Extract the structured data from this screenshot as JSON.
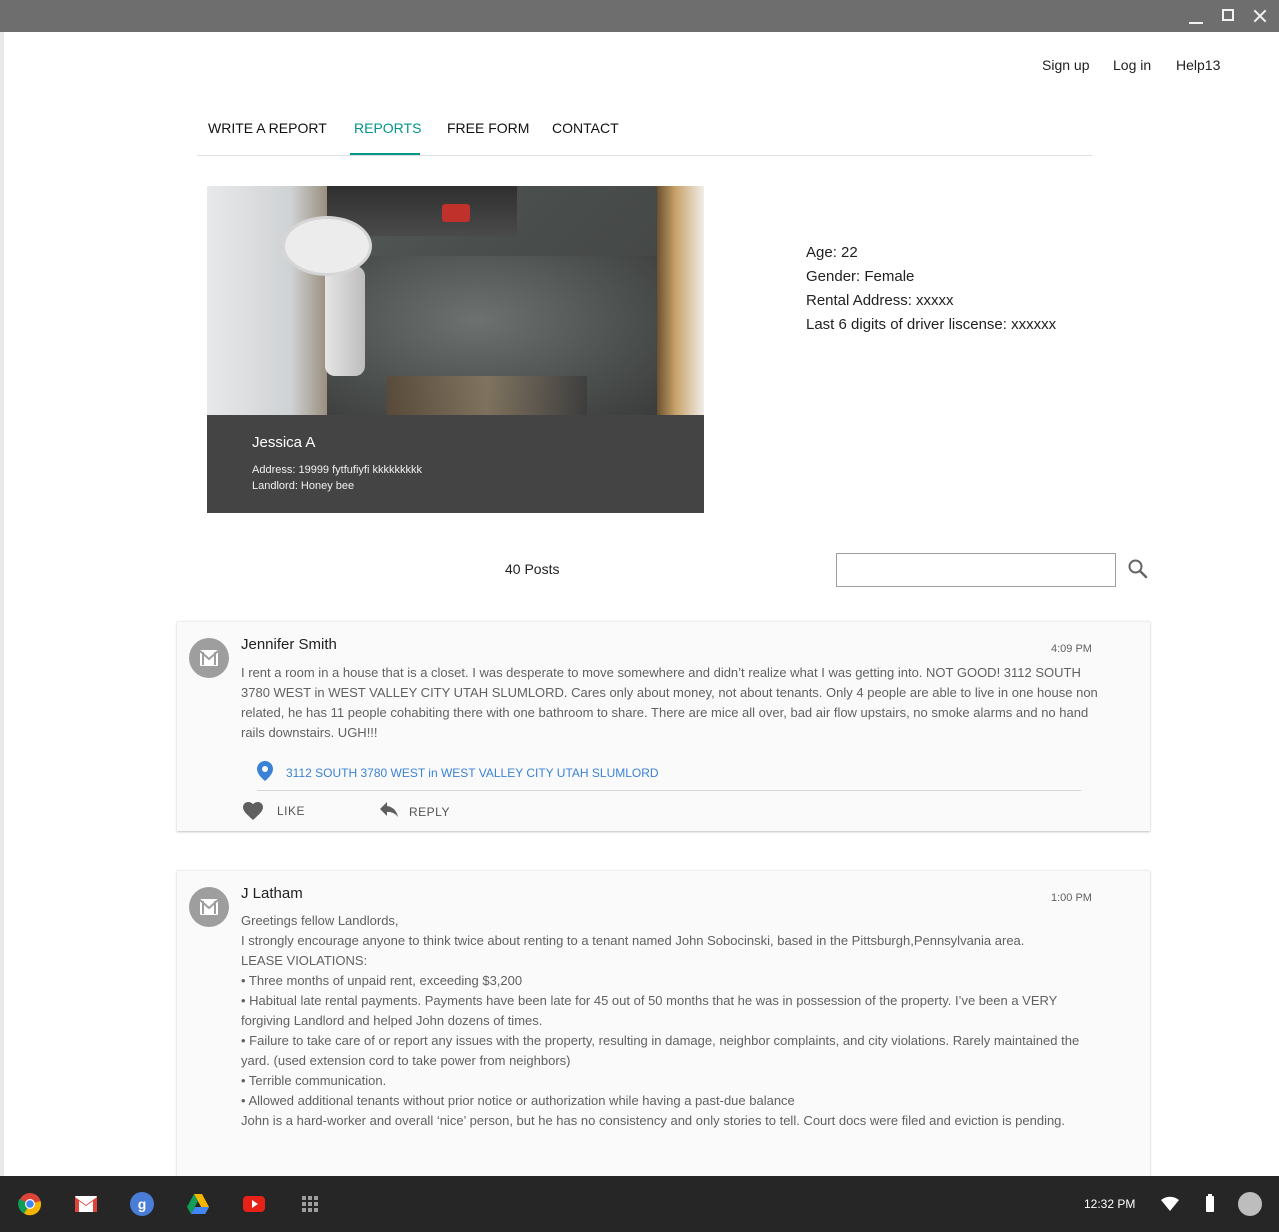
{
  "header": {
    "links": {
      "signup": "Sign up",
      "login": "Log in",
      "help": "Help13"
    }
  },
  "nav": {
    "items": [
      "WRITE A REPORT",
      "REPORTS",
      "FREE FORM",
      "CONTACT"
    ],
    "active_index": 1,
    "accent_color": "#009688"
  },
  "profile": {
    "name": "Jessica A",
    "address": "Address: 19999 fytfufiyfi kkkkkkkkk",
    "landlord": "Landlord: Honey bee",
    "details": [
      "Age: 22",
      "Gender: Female",
      "Rental Address: xxxxx",
      "Last 6 digits of driver liscense: xxxxxx"
    ]
  },
  "posts_summary": {
    "count_label": "40 Posts",
    "search_placeholder": ""
  },
  "posts": [
    {
      "author": "Jennifer Smith",
      "time": "4:09 PM",
      "body": [
        "I rent a room in a house that is a closet. I was desperate to move somewhere and didn’t realize what I was getting into. NOT GOOD! 3112 SOUTH 3780 WEST in WEST VALLEY CITY UTAH SLUMLORD. Cares only about money, not about tenants. Only 4 people are able to live in one house non related, he has 11 people cohabiting there with one bathroom to share. There are mice all over, bad air flow upstairs, no smoke alarms and no hand rails downstairs. UGH!!!"
      ],
      "location": "3112 SOUTH 3780 WEST in WEST VALLEY CITY UTAH SLUMLORD",
      "like_label": "LIKE",
      "reply_label": "REPLY"
    },
    {
      "author": "J Latham",
      "time": "1:00 PM",
      "body": [
        "Greetings fellow Landlords,",
        "I strongly encourage anyone to think twice about renting to a tenant named John Sobocinski, based in the Pittsburgh,Pennsylvania area.",
        "LEASE VIOLATIONS:",
        "• Three months of unpaid rent, exceeding $3,200",
        "• Habitual late rental payments. Payments have been late for 45 out of 50 months that he was in possession of the property. I’ve been a VERY forgiving Landlord and helped John dozens of times.",
        "• Failure to take care of or report any issues with the property, resulting in damage, neighbor complaints, and city violations. Rarely maintained the yard. (used extension cord to take power from neighbors)",
        "• Terrible communication.",
        "• Allowed additional tenants without prior notice or authorization while having a past-due balance",
        "John is a hard-worker and overall ‘nice’ person, but he has no consistency and only stories to tell. Court docs were filed and eviction is pending."
      ]
    }
  ],
  "taskbar": {
    "apps": [
      "chrome-icon",
      "gmail-icon",
      "google-plus-icon",
      "drive-icon",
      "youtube-icon",
      "app-launcher-icon"
    ],
    "clock": "12:32 PM"
  }
}
